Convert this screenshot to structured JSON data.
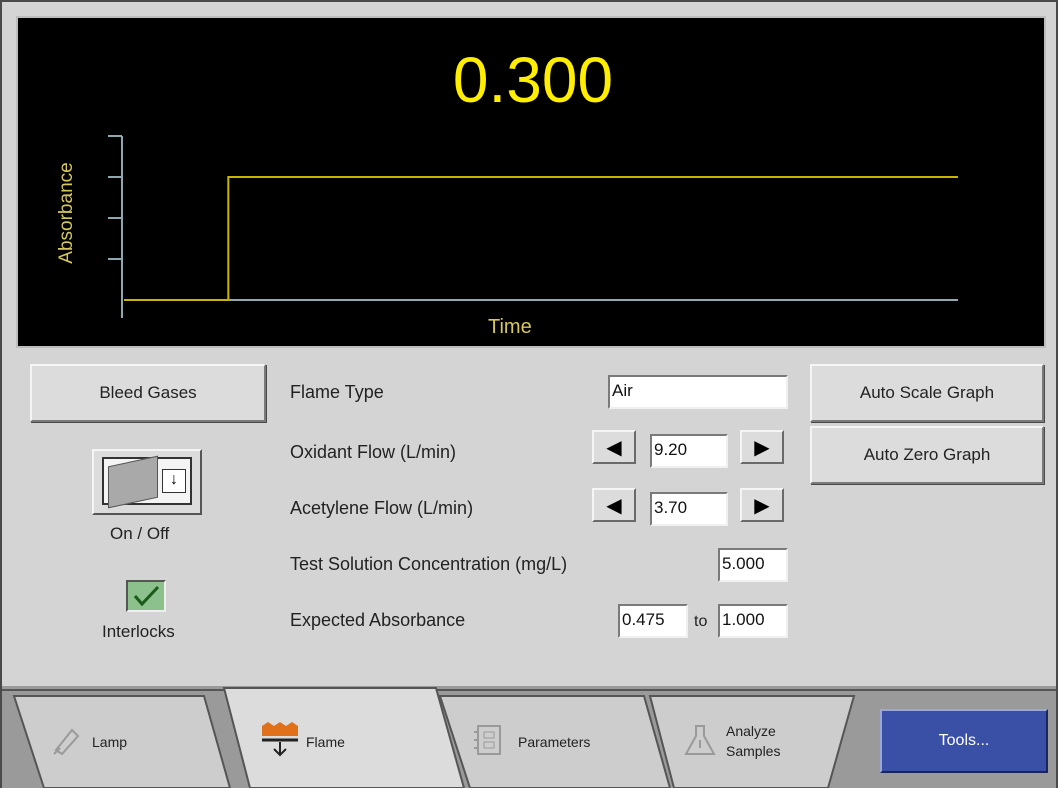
{
  "display": {
    "reading": "0.300",
    "y_axis_label": "Absorbance",
    "x_axis_label": "Time"
  },
  "chart_data": {
    "type": "line",
    "series": [
      {
        "x": [
          0,
          0.125,
          0.125,
          1
        ],
        "y": [
          0,
          0,
          0.3,
          0.3
        ],
        "color": "#c8b400"
      }
    ],
    "baseline": 0,
    "ylim": [
      0,
      0.4
    ],
    "xlim": [
      0,
      1
    ],
    "grid": false,
    "xlabel": "Time",
    "ylabel": "Absorbance",
    "colors": {
      "axis": "#8fa8b0",
      "trace": "#c8b400",
      "text": "#d6c75a"
    }
  },
  "controls": {
    "bleed_gases_label": "Bleed Gases",
    "on_off_label": "On / Off",
    "interlocks_label": "Interlocks",
    "interlocks_checked": true,
    "auto_scale_label": "Auto Scale Graph",
    "auto_zero_label": "Auto Zero Graph"
  },
  "settings": {
    "flame_type": {
      "label": "Flame Type",
      "value": "Air"
    },
    "oxidant_flow": {
      "label": "Oxidant Flow (L/min)",
      "value": "9.20"
    },
    "acetylene_flow": {
      "label": "Acetylene Flow (L/min)",
      "value": "3.70"
    },
    "test_solution": {
      "label": "Test Solution Concentration (mg/L)",
      "value": "5.000"
    },
    "expected_absorbance": {
      "label": "Expected Absorbance",
      "from": "0.475",
      "to_word": "to",
      "to": "1.000"
    }
  },
  "tabs": [
    {
      "label": "Lamp",
      "icon": "lamp-icon"
    },
    {
      "label": "Flame",
      "icon": "flame-icon",
      "active": true
    },
    {
      "label": "Parameters",
      "icon": "parameters-icon"
    },
    {
      "label_line1": "Analyze",
      "label_line2": "Samples",
      "icon": "analyze-flask-icon"
    }
  ],
  "tools_label": "Tools...",
  "colors": {
    "tools_bg": "#3a4fa6",
    "accent_yellow": "#ffee00",
    "flame_orange": "#e0701a"
  }
}
